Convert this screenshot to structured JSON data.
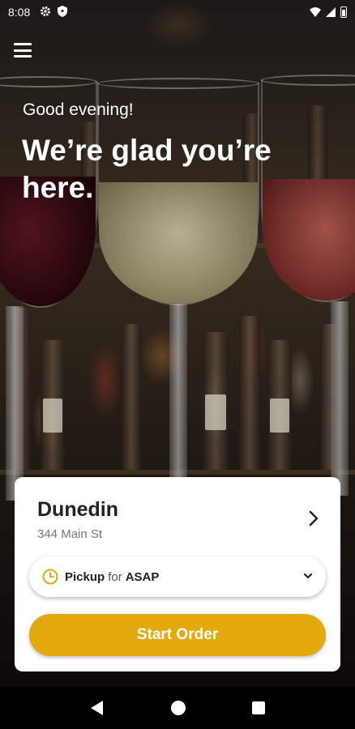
{
  "status_bar": {
    "time": "8:08",
    "icons": [
      "gear-icon",
      "shield-icon",
      "wifi-icon",
      "signal-icon",
      "battery-icon"
    ]
  },
  "header": {
    "menu_icon": "hamburger-menu-icon"
  },
  "hero": {
    "greeting": "Good evening!",
    "headline": "We’re glad you’re here."
  },
  "location": {
    "name": "Dunedin",
    "address": "344 Main St"
  },
  "pickup": {
    "mode": "Pickup",
    "connector": "for",
    "time": "ASAP"
  },
  "actions": {
    "start_order_label": "Start Order"
  },
  "colors": {
    "accent": "#e3a90d",
    "card_background": "#ffffff",
    "text_primary": "#222222",
    "text_secondary": "#777777"
  },
  "nav_bar": {
    "icons": [
      "back-icon",
      "home-icon",
      "recent-apps-icon"
    ]
  }
}
